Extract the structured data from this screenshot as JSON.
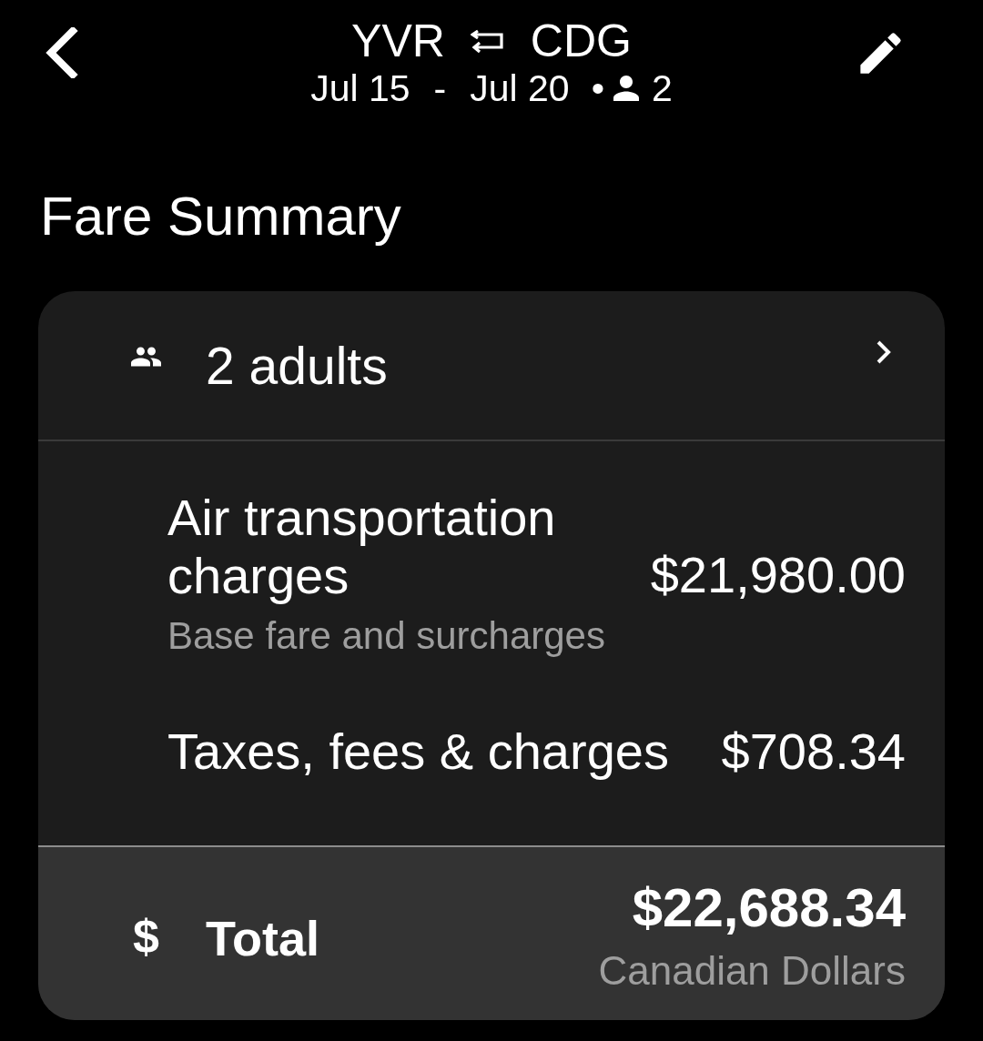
{
  "header": {
    "origin": "YVR",
    "destination": "CDG",
    "date_from": "Jul 15",
    "date_separator": "-",
    "date_to": "Jul 20",
    "bullet": "•",
    "travelers": "2"
  },
  "heading": "Fare Summary",
  "card": {
    "passengers": {
      "label": "2 adults"
    },
    "line_items": [
      {
        "label": "Air transportation charges",
        "note": "Base fare and surcharges",
        "amount": "$21,980.00"
      },
      {
        "label": "Taxes, fees & charges",
        "amount": "$708.34"
      }
    ],
    "total": {
      "symbol": "$",
      "label": "Total",
      "amount": "$22,688.34",
      "currency": "Canadian Dollars"
    }
  }
}
